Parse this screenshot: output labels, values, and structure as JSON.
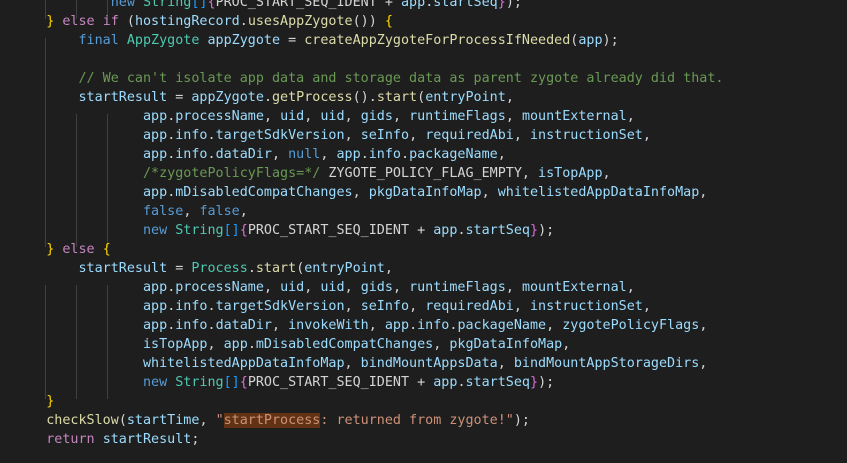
{
  "editor": {
    "lines": [
      [
        {
          "t": "            ",
          "c": "plain"
        },
        {
          "t": "new",
          "c": "kw"
        },
        {
          "t": " ",
          "c": "plain"
        },
        {
          "t": "String",
          "c": "type"
        },
        {
          "t": "[]",
          "c": "bracket"
        },
        {
          "t": "{",
          "c": "paren"
        },
        {
          "t": "PROC_START_SEQ_IDENT + ",
          "c": "plain"
        },
        {
          "t": "app",
          "c": "var"
        },
        {
          "t": ".",
          "c": "plain"
        },
        {
          "t": "startSeq",
          "c": "var"
        },
        {
          "t": "}",
          "c": "paren"
        },
        {
          "t": ");",
          "c": "plain"
        }
      ],
      [
        {
          "t": "    ",
          "c": "plain"
        },
        {
          "t": "}",
          "c": "brace"
        },
        {
          "t": " ",
          "c": "plain"
        },
        {
          "t": "else",
          "c": "ctrl"
        },
        {
          "t": " ",
          "c": "plain"
        },
        {
          "t": "if",
          "c": "ctrl"
        },
        {
          "t": " (",
          "c": "plain"
        },
        {
          "t": "hostingRecord",
          "c": "var"
        },
        {
          "t": ".",
          "c": "plain"
        },
        {
          "t": "usesAppZygote",
          "c": "fn"
        },
        {
          "t": "()) ",
          "c": "plain"
        },
        {
          "t": "{",
          "c": "brace"
        }
      ],
      [
        {
          "t": "        ",
          "c": "plain"
        },
        {
          "t": "final",
          "c": "kw"
        },
        {
          "t": " ",
          "c": "plain"
        },
        {
          "t": "AppZygote",
          "c": "type"
        },
        {
          "t": " ",
          "c": "plain"
        },
        {
          "t": "appZygote",
          "c": "var"
        },
        {
          "t": " = ",
          "c": "plain"
        },
        {
          "t": "createAppZygoteForProcessIfNeeded",
          "c": "fn"
        },
        {
          "t": "(",
          "c": "plain"
        },
        {
          "t": "app",
          "c": "var"
        },
        {
          "t": ");",
          "c": "plain"
        }
      ],
      [],
      [
        {
          "t": "        ",
          "c": "plain"
        },
        {
          "t": "// We can't isolate app data and storage data as parent zygote already did that.",
          "c": "comment"
        }
      ],
      [
        {
          "t": "        ",
          "c": "plain"
        },
        {
          "t": "startResult",
          "c": "var"
        },
        {
          "t": " = ",
          "c": "plain"
        },
        {
          "t": "appZygote",
          "c": "var"
        },
        {
          "t": ".",
          "c": "plain"
        },
        {
          "t": "getProcess",
          "c": "fn"
        },
        {
          "t": "().",
          "c": "plain"
        },
        {
          "t": "start",
          "c": "fn"
        },
        {
          "t": "(",
          "c": "plain"
        },
        {
          "t": "entryPoint",
          "c": "var"
        },
        {
          "t": ",",
          "c": "plain"
        }
      ],
      [
        {
          "t": "                ",
          "c": "plain"
        },
        {
          "t": "app",
          "c": "var"
        },
        {
          "t": ".",
          "c": "plain"
        },
        {
          "t": "processName",
          "c": "var"
        },
        {
          "t": ", ",
          "c": "plain"
        },
        {
          "t": "uid",
          "c": "var"
        },
        {
          "t": ", ",
          "c": "plain"
        },
        {
          "t": "uid",
          "c": "var"
        },
        {
          "t": ", ",
          "c": "plain"
        },
        {
          "t": "gids",
          "c": "var"
        },
        {
          "t": ", ",
          "c": "plain"
        },
        {
          "t": "runtimeFlags",
          "c": "var"
        },
        {
          "t": ", ",
          "c": "plain"
        },
        {
          "t": "mountExternal",
          "c": "var"
        },
        {
          "t": ",",
          "c": "plain"
        }
      ],
      [
        {
          "t": "                ",
          "c": "plain"
        },
        {
          "t": "app",
          "c": "var"
        },
        {
          "t": ".",
          "c": "plain"
        },
        {
          "t": "info",
          "c": "var"
        },
        {
          "t": ".",
          "c": "plain"
        },
        {
          "t": "targetSdkVersion",
          "c": "var"
        },
        {
          "t": ", ",
          "c": "plain"
        },
        {
          "t": "seInfo",
          "c": "var"
        },
        {
          "t": ", ",
          "c": "plain"
        },
        {
          "t": "requiredAbi",
          "c": "var"
        },
        {
          "t": ", ",
          "c": "plain"
        },
        {
          "t": "instructionSet",
          "c": "var"
        },
        {
          "t": ",",
          "c": "plain"
        }
      ],
      [
        {
          "t": "                ",
          "c": "plain"
        },
        {
          "t": "app",
          "c": "var"
        },
        {
          "t": ".",
          "c": "plain"
        },
        {
          "t": "info",
          "c": "var"
        },
        {
          "t": ".",
          "c": "plain"
        },
        {
          "t": "dataDir",
          "c": "var"
        },
        {
          "t": ", ",
          "c": "plain"
        },
        {
          "t": "null",
          "c": "kw"
        },
        {
          "t": ", ",
          "c": "plain"
        },
        {
          "t": "app",
          "c": "var"
        },
        {
          "t": ".",
          "c": "plain"
        },
        {
          "t": "info",
          "c": "var"
        },
        {
          "t": ".",
          "c": "plain"
        },
        {
          "t": "packageName",
          "c": "var"
        },
        {
          "t": ",",
          "c": "plain"
        }
      ],
      [
        {
          "t": "                ",
          "c": "plain"
        },
        {
          "t": "/*zygotePolicyFlags=*/",
          "c": "comment"
        },
        {
          "t": " ZYGOTE_POLICY_FLAG_EMPTY, ",
          "c": "plain"
        },
        {
          "t": "isTopApp",
          "c": "var"
        },
        {
          "t": ",",
          "c": "plain"
        }
      ],
      [
        {
          "t": "                ",
          "c": "plain"
        },
        {
          "t": "app",
          "c": "var"
        },
        {
          "t": ".",
          "c": "plain"
        },
        {
          "t": "mDisabledCompatChanges",
          "c": "var"
        },
        {
          "t": ", ",
          "c": "plain"
        },
        {
          "t": "pkgDataInfoMap",
          "c": "var"
        },
        {
          "t": ", ",
          "c": "plain"
        },
        {
          "t": "whitelistedAppDataInfoMap",
          "c": "var"
        },
        {
          "t": ",",
          "c": "plain"
        }
      ],
      [
        {
          "t": "                ",
          "c": "plain"
        },
        {
          "t": "false",
          "c": "kw"
        },
        {
          "t": ", ",
          "c": "plain"
        },
        {
          "t": "false",
          "c": "kw"
        },
        {
          "t": ",",
          "c": "plain"
        }
      ],
      [
        {
          "t": "                ",
          "c": "plain"
        },
        {
          "t": "new",
          "c": "kw"
        },
        {
          "t": " ",
          "c": "plain"
        },
        {
          "t": "String",
          "c": "type"
        },
        {
          "t": "[]",
          "c": "bracket"
        },
        {
          "t": "{",
          "c": "paren"
        },
        {
          "t": "PROC_START_SEQ_IDENT + ",
          "c": "plain"
        },
        {
          "t": "app",
          "c": "var"
        },
        {
          "t": ".",
          "c": "plain"
        },
        {
          "t": "startSeq",
          "c": "var"
        },
        {
          "t": "}",
          "c": "paren"
        },
        {
          "t": ");",
          "c": "plain"
        }
      ],
      [
        {
          "t": "    ",
          "c": "plain"
        },
        {
          "t": "}",
          "c": "brace"
        },
        {
          "t": " ",
          "c": "plain"
        },
        {
          "t": "else",
          "c": "ctrl"
        },
        {
          "t": " ",
          "c": "plain"
        },
        {
          "t": "{",
          "c": "brace"
        }
      ],
      [
        {
          "t": "        ",
          "c": "plain"
        },
        {
          "t": "startResult",
          "c": "var"
        },
        {
          "t": " = ",
          "c": "plain"
        },
        {
          "t": "Process",
          "c": "type"
        },
        {
          "t": ".",
          "c": "plain"
        },
        {
          "t": "start",
          "c": "fn"
        },
        {
          "t": "(",
          "c": "plain"
        },
        {
          "t": "entryPoint",
          "c": "var"
        },
        {
          "t": ",",
          "c": "plain"
        }
      ],
      [
        {
          "t": "                ",
          "c": "plain"
        },
        {
          "t": "app",
          "c": "var"
        },
        {
          "t": ".",
          "c": "plain"
        },
        {
          "t": "processName",
          "c": "var"
        },
        {
          "t": ", ",
          "c": "plain"
        },
        {
          "t": "uid",
          "c": "var"
        },
        {
          "t": ", ",
          "c": "plain"
        },
        {
          "t": "uid",
          "c": "var"
        },
        {
          "t": ", ",
          "c": "plain"
        },
        {
          "t": "gids",
          "c": "var"
        },
        {
          "t": ", ",
          "c": "plain"
        },
        {
          "t": "runtimeFlags",
          "c": "var"
        },
        {
          "t": ", ",
          "c": "plain"
        },
        {
          "t": "mountExternal",
          "c": "var"
        },
        {
          "t": ",",
          "c": "plain"
        }
      ],
      [
        {
          "t": "                ",
          "c": "plain"
        },
        {
          "t": "app",
          "c": "var"
        },
        {
          "t": ".",
          "c": "plain"
        },
        {
          "t": "info",
          "c": "var"
        },
        {
          "t": ".",
          "c": "plain"
        },
        {
          "t": "targetSdkVersion",
          "c": "var"
        },
        {
          "t": ", ",
          "c": "plain"
        },
        {
          "t": "seInfo",
          "c": "var"
        },
        {
          "t": ", ",
          "c": "plain"
        },
        {
          "t": "requiredAbi",
          "c": "var"
        },
        {
          "t": ", ",
          "c": "plain"
        },
        {
          "t": "instructionSet",
          "c": "var"
        },
        {
          "t": ",",
          "c": "plain"
        }
      ],
      [
        {
          "t": "                ",
          "c": "plain"
        },
        {
          "t": "app",
          "c": "var"
        },
        {
          "t": ".",
          "c": "plain"
        },
        {
          "t": "info",
          "c": "var"
        },
        {
          "t": ".",
          "c": "plain"
        },
        {
          "t": "dataDir",
          "c": "var"
        },
        {
          "t": ", ",
          "c": "plain"
        },
        {
          "t": "invokeWith",
          "c": "var"
        },
        {
          "t": ", ",
          "c": "plain"
        },
        {
          "t": "app",
          "c": "var"
        },
        {
          "t": ".",
          "c": "plain"
        },
        {
          "t": "info",
          "c": "var"
        },
        {
          "t": ".",
          "c": "plain"
        },
        {
          "t": "packageName",
          "c": "var"
        },
        {
          "t": ", ",
          "c": "plain"
        },
        {
          "t": "zygotePolicyFlags",
          "c": "var"
        },
        {
          "t": ",",
          "c": "plain"
        }
      ],
      [
        {
          "t": "                ",
          "c": "plain"
        },
        {
          "t": "isTopApp",
          "c": "var"
        },
        {
          "t": ", ",
          "c": "plain"
        },
        {
          "t": "app",
          "c": "var"
        },
        {
          "t": ".",
          "c": "plain"
        },
        {
          "t": "mDisabledCompatChanges",
          "c": "var"
        },
        {
          "t": ", ",
          "c": "plain"
        },
        {
          "t": "pkgDataInfoMap",
          "c": "var"
        },
        {
          "t": ",",
          "c": "plain"
        }
      ],
      [
        {
          "t": "                ",
          "c": "plain"
        },
        {
          "t": "whitelistedAppDataInfoMap",
          "c": "var"
        },
        {
          "t": ", ",
          "c": "plain"
        },
        {
          "t": "bindMountAppsData",
          "c": "var"
        },
        {
          "t": ", ",
          "c": "plain"
        },
        {
          "t": "bindMountAppStorageDirs",
          "c": "var"
        },
        {
          "t": ",",
          "c": "plain"
        }
      ],
      [
        {
          "t": "                ",
          "c": "plain"
        },
        {
          "t": "new",
          "c": "kw"
        },
        {
          "t": " ",
          "c": "plain"
        },
        {
          "t": "String",
          "c": "type"
        },
        {
          "t": "[]",
          "c": "bracket"
        },
        {
          "t": "{",
          "c": "paren"
        },
        {
          "t": "PROC_START_SEQ_IDENT + ",
          "c": "plain"
        },
        {
          "t": "app",
          "c": "var"
        },
        {
          "t": ".",
          "c": "plain"
        },
        {
          "t": "startSeq",
          "c": "var"
        },
        {
          "t": "}",
          "c": "paren"
        },
        {
          "t": ");",
          "c": "plain"
        }
      ],
      [
        {
          "t": "    ",
          "c": "plain"
        },
        {
          "t": "}",
          "c": "brace"
        }
      ],
      [
        {
          "t": "    ",
          "c": "plain"
        },
        {
          "t": "checkSlow",
          "c": "fn"
        },
        {
          "t": "(",
          "c": "plain"
        },
        {
          "t": "startTime",
          "c": "var"
        },
        {
          "t": ", ",
          "c": "plain"
        },
        {
          "t": "\"",
          "c": "str"
        },
        {
          "t": "startProcess",
          "c": "hl"
        },
        {
          "t": ": returned from zygote!\"",
          "c": "str"
        },
        {
          "t": ");",
          "c": "plain"
        }
      ],
      [
        {
          "t": "    ",
          "c": "plain"
        },
        {
          "t": "return",
          "c": "ctrl"
        },
        {
          "t": " ",
          "c": "plain"
        },
        {
          "t": "startResult",
          "c": "var"
        },
        {
          "t": ";",
          "c": "plain"
        }
      ]
    ]
  },
  "colors": {
    "background": "#1e1e1e",
    "keyword": "#569cd6",
    "control": "#c586c0",
    "type": "#4ec9b0",
    "function": "#dcdcaa",
    "variable": "#9cdcfe",
    "comment": "#6a9955",
    "string": "#ce9178",
    "highlight_bg": "#613214"
  }
}
